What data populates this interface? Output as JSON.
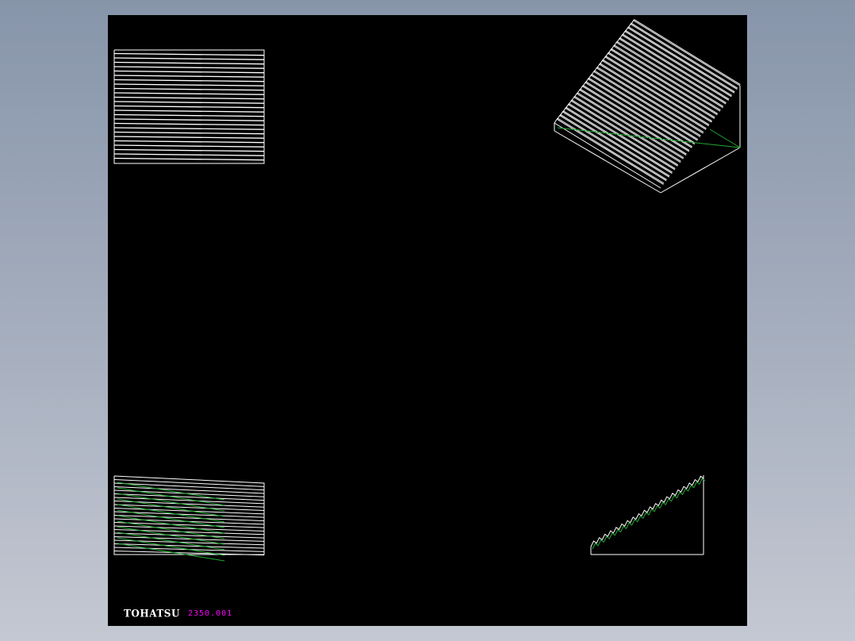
{
  "title_block": {
    "logo_text": "TOHATSU",
    "drawing_number": "2350.001"
  },
  "colors": {
    "canvas_background": "#000000",
    "outer_background": "#9aa4b5",
    "linework": "#ffffff",
    "hidden_lines": "#22aa33",
    "drawing_number": "#ff00ff"
  },
  "views": [
    {
      "name": "front-view",
      "type": "orthographic",
      "linework": "white horizontal grooves"
    },
    {
      "name": "isometric-view",
      "type": "isometric",
      "linework": "white serrated surface with green hidden edges"
    },
    {
      "name": "top-view",
      "type": "orthographic",
      "linework": "white lines with green hidden lines"
    },
    {
      "name": "side-view",
      "type": "orthographic",
      "linework": "serrated triangular profile"
    }
  ]
}
